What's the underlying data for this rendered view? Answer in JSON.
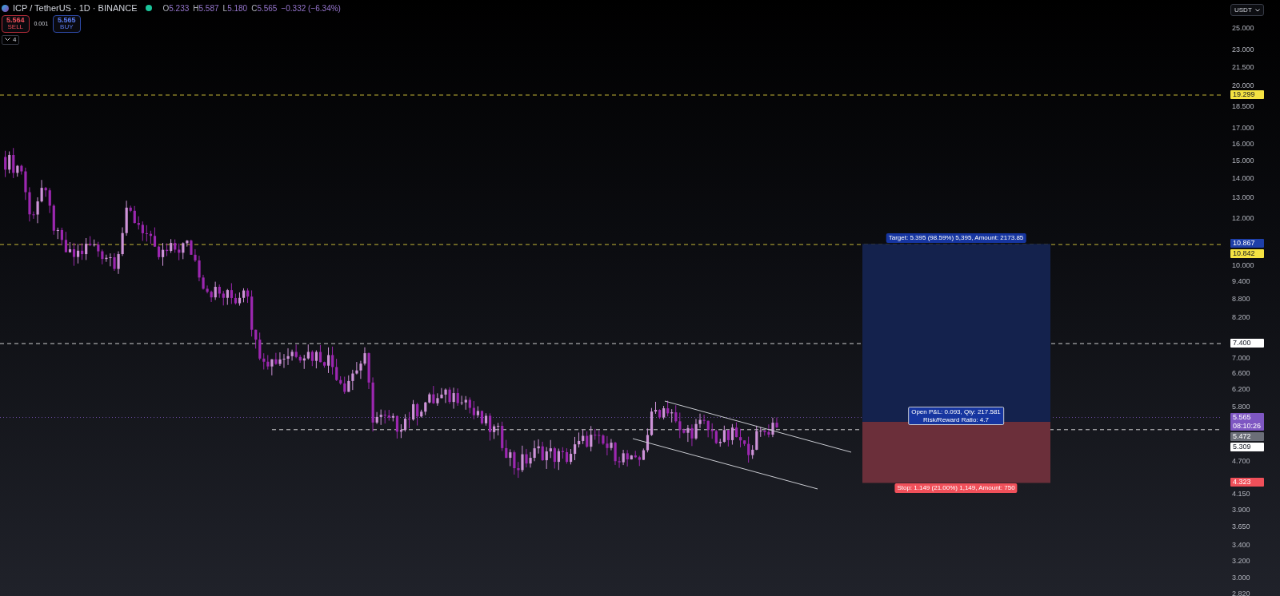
{
  "header": {
    "symbol": "ICP / TetherUS · 1D · BINANCE",
    "market_open": true,
    "ohlc": [
      {
        "label": "O",
        "value": "5.233"
      },
      {
        "label": "H",
        "value": "5.587"
      },
      {
        "label": "L",
        "value": "5.180"
      },
      {
        "label": "C",
        "value": "5.565"
      }
    ],
    "change": "−0.332 (−6.34%)"
  },
  "trade": {
    "sell": {
      "price": "5.564",
      "label": "SELL"
    },
    "spread": "0.001",
    "buy": {
      "price": "5.565",
      "label": "BUY"
    }
  },
  "indicators_toggle": {
    "count": "4"
  },
  "price_axis": {
    "currency": "USDT",
    "ticks": [
      "25.000",
      "23.000",
      "21.500",
      "20.000",
      "18.500",
      "17.000",
      "16.000",
      "15.000",
      "14.000",
      "13.000",
      "12.000",
      "10.000",
      "9.400",
      "8.800",
      "8.200",
      "7.000",
      "6.600",
      "6.200",
      "5.800",
      "4.700",
      "4.150",
      "3.900",
      "3.650",
      "3.400",
      "3.200",
      "3.000",
      "2.820"
    ]
  },
  "price_tags": [
    {
      "value": "19.299",
      "color": "#f5e342",
      "kind": "line"
    },
    {
      "value": "10.867",
      "color": "#1e3fa8",
      "kind": "target"
    },
    {
      "value": "10.842",
      "color": "#f5e342",
      "kind": "line"
    },
    {
      "value": "7.400",
      "color": "#ffffff",
      "kind": "line"
    },
    {
      "value": "5.565",
      "time": "08:10:26",
      "color": "#7e57c2",
      "kind": "last"
    },
    {
      "value": "5.472",
      "color": "#6b6e78",
      "kind": "entry"
    },
    {
      "value": "5.309",
      "color": "#ffffff",
      "kind": "ray"
    },
    {
      "value": "4.323",
      "color": "#f0505a",
      "kind": "stop"
    }
  ],
  "position": {
    "target_label": "Target: 5.395 (98.59%) 5,395, Amount: 2173.85",
    "pnl_label": "Open P&L: 0.093, Qty: 217.581",
    "ratio_label": "Risk/Reward Ratio: 4.7",
    "stop_label": "Stop: 1.149 (21.00%) 1,149, Amount: 750"
  }
}
